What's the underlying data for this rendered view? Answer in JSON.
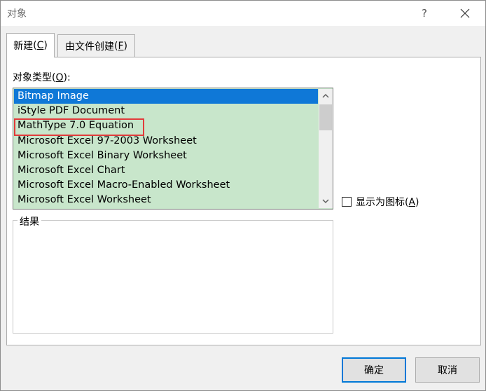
{
  "window": {
    "title": "对象",
    "help_glyph": "?"
  },
  "tabs": [
    {
      "label": "新建",
      "mnemonic": "C"
    },
    {
      "label": "由文件创建",
      "mnemonic": "F"
    }
  ],
  "object_type": {
    "label": "对象类型",
    "mnemonic": "O",
    "items": [
      "Bitmap Image",
      "iStyle PDF Document",
      "MathType 7.0 Equation",
      "Microsoft Excel 97-2003 Worksheet",
      "Microsoft Excel Binary Worksheet",
      "Microsoft Excel Chart",
      "Microsoft Excel Macro-Enabled Worksheet",
      "Microsoft Excel Worksheet"
    ],
    "selected_index": 0,
    "highlighted_index": 2
  },
  "display_as_icon": {
    "label": "显示为图标",
    "mnemonic": "A",
    "checked": false
  },
  "result": {
    "label": "结果"
  },
  "buttons": {
    "ok": "确定",
    "cancel": "取消"
  },
  "colors": {
    "selection": "#0f78d7",
    "list_background": "#c8e6cb",
    "highlight_outline": "#e23b3b",
    "default_button_border": "#0078d7"
  }
}
